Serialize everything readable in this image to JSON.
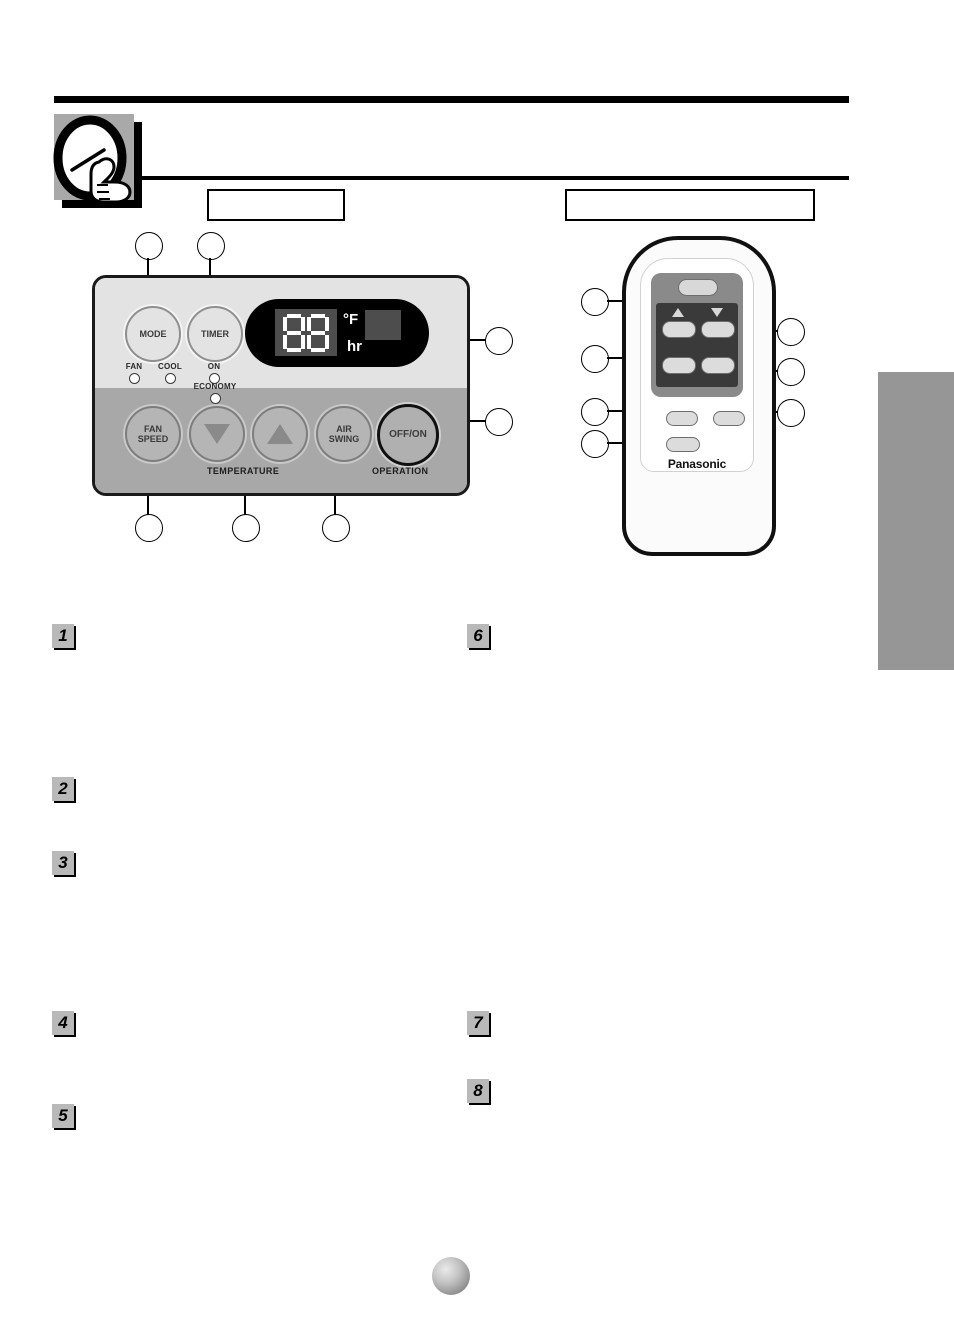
{
  "document": {
    "brand": "Panasonic",
    "page_number": ""
  },
  "header": {
    "chapter_icon": "clock-hand-icon",
    "title": "",
    "panel_box_label": "",
    "remote_box_label": ""
  },
  "control_panel": {
    "buttons": {
      "mode": "MODE",
      "timer": "TIMER",
      "fan_speed_line1": "FAN",
      "fan_speed_line2": "SPEED",
      "air_swing_line1": "AIR",
      "air_swing_line2": "SWING",
      "off_on": "OFF/ON",
      "temp_down": "",
      "temp_up": ""
    },
    "indicators": [
      {
        "label": "FAN"
      },
      {
        "label": "COOL"
      },
      {
        "label": "ON"
      },
      {
        "label": "ECONOMY"
      }
    ],
    "group_labels": {
      "temperature": "TEMPERATURE",
      "operation": "OPERATION"
    },
    "display": {
      "digits": "88",
      "unit_temperature": "°F",
      "unit_time": "hr",
      "indicator_block": ""
    },
    "callouts": [
      {
        "id": "cp-callout-mode",
        "label": ""
      },
      {
        "id": "cp-callout-timer",
        "label": ""
      },
      {
        "id": "cp-callout-display",
        "label": ""
      },
      {
        "id": "cp-callout-offon",
        "label": ""
      },
      {
        "id": "cp-callout-fanspeed",
        "label": ""
      },
      {
        "id": "cp-callout-temperature",
        "label": ""
      },
      {
        "id": "cp-callout-airswing",
        "label": ""
      }
    ]
  },
  "remote": {
    "brand": "Panasonic",
    "keys": {
      "top": "",
      "temp_up": "",
      "temp_down": "",
      "left_mid": "",
      "right_mid": "",
      "low_left": "",
      "low_right": "",
      "low_bottom": ""
    },
    "callouts": [
      {
        "id": "rm-callout-1",
        "label": ""
      },
      {
        "id": "rm-callout-2",
        "label": ""
      },
      {
        "id": "rm-callout-3",
        "label": ""
      },
      {
        "id": "rm-callout-4",
        "label": ""
      },
      {
        "id": "rm-callout-5",
        "label": ""
      },
      {
        "id": "rm-callout-6",
        "label": ""
      },
      {
        "id": "rm-callout-7",
        "label": ""
      }
    ]
  },
  "steps": [
    {
      "number": "1",
      "text": ""
    },
    {
      "number": "2",
      "text": ""
    },
    {
      "number": "3",
      "text": ""
    },
    {
      "number": "4",
      "text": ""
    },
    {
      "number": "5",
      "text": ""
    },
    {
      "number": "6",
      "text": ""
    },
    {
      "number": "7",
      "text": ""
    },
    {
      "number": "8",
      "text": ""
    }
  ],
  "colors": {
    "panel_upper": "#e3e3e3",
    "panel_lower": "#a8a8a8",
    "display_background": "#000000",
    "side_tab": "#969696",
    "marker_background": "#b9b9b9"
  }
}
